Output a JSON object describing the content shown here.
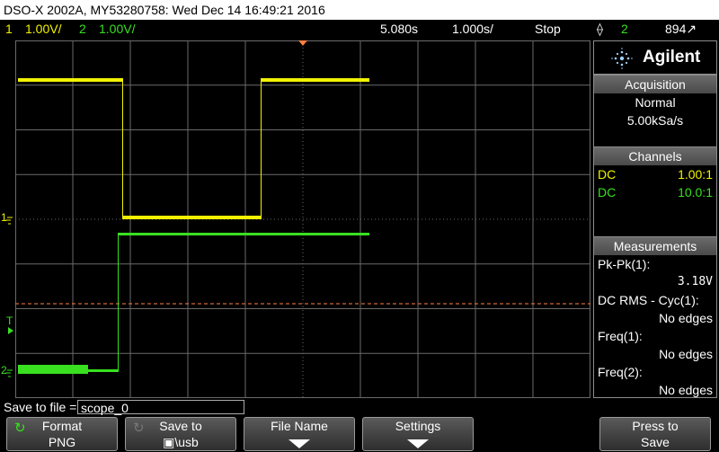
{
  "title_bar": {
    "text": "DSO-X 2002A, MY53280758: Wed Dec 14 16:49:21 2016"
  },
  "status_bar": {
    "ch1_num": "1",
    "ch1_scale": "1.00V/",
    "ch2_num": "2",
    "ch2_scale": "1.00V/",
    "time_offset": "5.080s",
    "time_scale": "1.000s/",
    "run_state": "Stop",
    "trigger_icon": "falling-edge-trigger",
    "trigger_source": "2",
    "trigger_level": "894↗"
  },
  "colors": {
    "ch1": "#f2f200",
    "ch2": "#38e020",
    "trigger_level": "#ff8040",
    "grid": "#6a6a6a"
  },
  "panel": {
    "brand": "Agilent",
    "acquisition": {
      "header": "Acquisition",
      "mode": "Normal",
      "rate": "5.00kSa/s"
    },
    "channels": {
      "header": "Channels",
      "rows": [
        {
          "coupling": "DC",
          "probe": "1.00:1"
        },
        {
          "coupling": "DC",
          "probe": "10.0:1"
        }
      ]
    },
    "measurements": {
      "header": "Measurements",
      "items": [
        {
          "label": "Pk-Pk(1):",
          "value": "3.18V"
        },
        {
          "label": "DC RMS - Cyc(1):",
          "value": "No edges"
        },
        {
          "label": "Freq(1):",
          "value": "No edges"
        },
        {
          "label": "Freq(2):",
          "value": "No edges"
        }
      ]
    }
  },
  "markers": {
    "ch1_ground": "1",
    "trigger_t": "T",
    "ch2_ground": "2"
  },
  "save": {
    "label": "Save to file =",
    "value": "scope_0"
  },
  "softkeys": {
    "format": {
      "line1": "Format",
      "line2": "PNG"
    },
    "save_to": {
      "line1": "Save to",
      "line2": "▣\\usb"
    },
    "file_name": {
      "line1": "File Name"
    },
    "settings": {
      "line1": "Settings"
    },
    "press_to_save": {
      "line1": "Press to",
      "line2": "Save"
    }
  }
}
